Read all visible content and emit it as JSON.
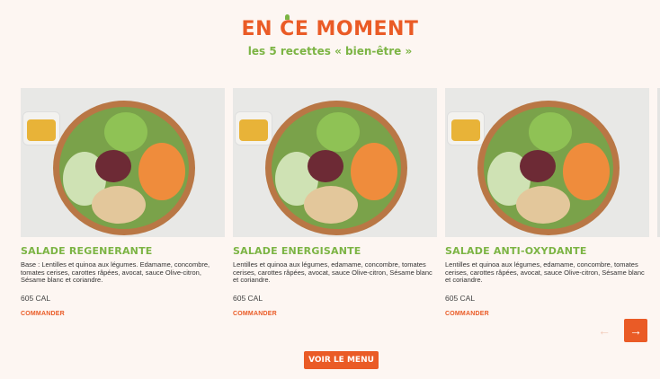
{
  "header": {
    "title_part1": "EN ",
    "title_carrot": "C",
    "title_part2": "E MOMENT",
    "subtitle": "les 5 recettes « bien-être »"
  },
  "cards": [
    {
      "name": "SALADE REGENERANTE",
      "description": "Base : Lentilles et quinoa aux légumes. Edamame, concombre, tomates cerises, carottes râpées, avocat, sauce Olive-citron, Sésame blanc et coriandre.",
      "calories": "605 CAL",
      "cta": "COMMANDER"
    },
    {
      "name": "SALADE ENERGISANTE",
      "description": "Lentilles et quinoa aux légumes, edamame, concombre, tomates cerises, carottes râpées, avocat, sauce Olive-citron, Sésame blanc et coriandre.",
      "calories": "605 CAL",
      "cta": "COMMANDER"
    },
    {
      "name": "SALADE ANTI-OXYDANTE",
      "description": "Lentilles et quinoa aux légumes, edamame, concombre, tomates cerises, carottes râpées, avocat, sauce Olive-citron, Sésame blanc et coriandre.",
      "calories": "605 CAL",
      "cta": "COMMANDER"
    }
  ],
  "carousel": {
    "prev_icon": "←",
    "next_icon": "→"
  },
  "menu_button": "VOIR LE MENU",
  "colors": {
    "accent_orange": "#ea5b26",
    "accent_green": "#7cb444",
    "background": "#fdf6f2"
  }
}
